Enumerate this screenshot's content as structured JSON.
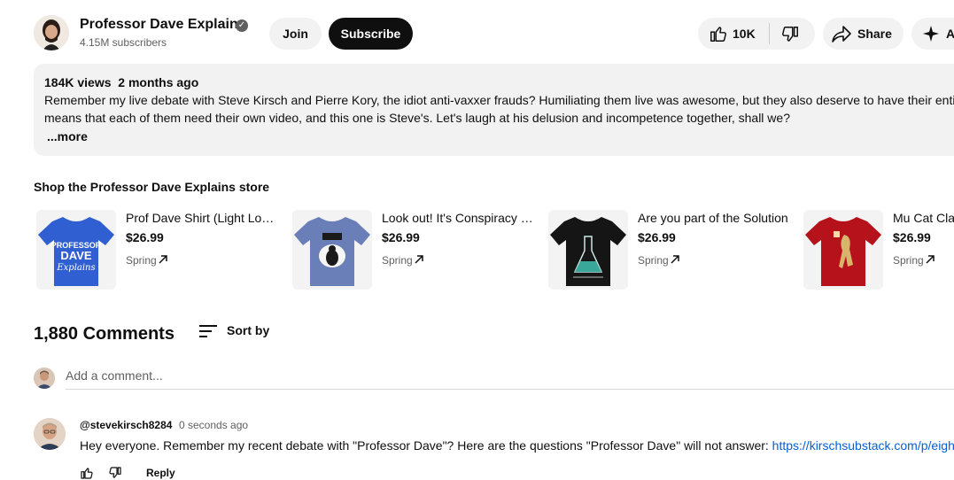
{
  "channel": {
    "name": "Professor Dave Explains",
    "subscribers": "4.15M subscribers",
    "verified_icon": "verified-check-icon",
    "join_label": "Join",
    "subscribe_label": "Subscribe"
  },
  "actions": {
    "like_count": "10K",
    "share_label": "Share",
    "more_label": "A"
  },
  "description": {
    "views": "184K views",
    "age": "2 months ago",
    "line1": "Remember my live debate with Steve Kirsch and Pierre Kory, the idiot anti-vaxxer frauds? Humiliating them live was awesome, but they also deserve to have their entire",
    "line2": "means that each of them need their own video, and this one is Steve's. Let's laugh at his delusion and incompetence together, shall we?",
    "more_label": "...more"
  },
  "store": {
    "title": "Shop the Professor Dave Explains store",
    "products": [
      {
        "name": "Prof Dave Shirt (Light Logo)",
        "price": "$26.99",
        "vendor": "Spring",
        "color": "#2f5fd0"
      },
      {
        "name": "Look out! It's Conspiracy Penguin",
        "price": "$26.99",
        "vendor": "Spring",
        "color": "#6a7fb8"
      },
      {
        "name": "Are you part of the Solution",
        "price": "$26.99",
        "vendor": "Spring",
        "color": "#151515"
      },
      {
        "name": "Mu Cat Classic",
        "price": "$26.99",
        "vendor": "Spring",
        "color": "#b5121b"
      }
    ]
  },
  "comments": {
    "count": "1,880 Comments",
    "sort_label": "Sort by",
    "add_placeholder": "Add a comment...",
    "items": [
      {
        "author": "@stevekirsch8284",
        "time": "0 seconds ago",
        "text": "Hey everyone. Remember my recent debate with \"Professor Dave\"?  Here are the questions \"Professor Dave\" will not answer: ",
        "link": "https://kirschsubstack.com/p/eight",
        "reply_label": "Reply"
      }
    ]
  }
}
